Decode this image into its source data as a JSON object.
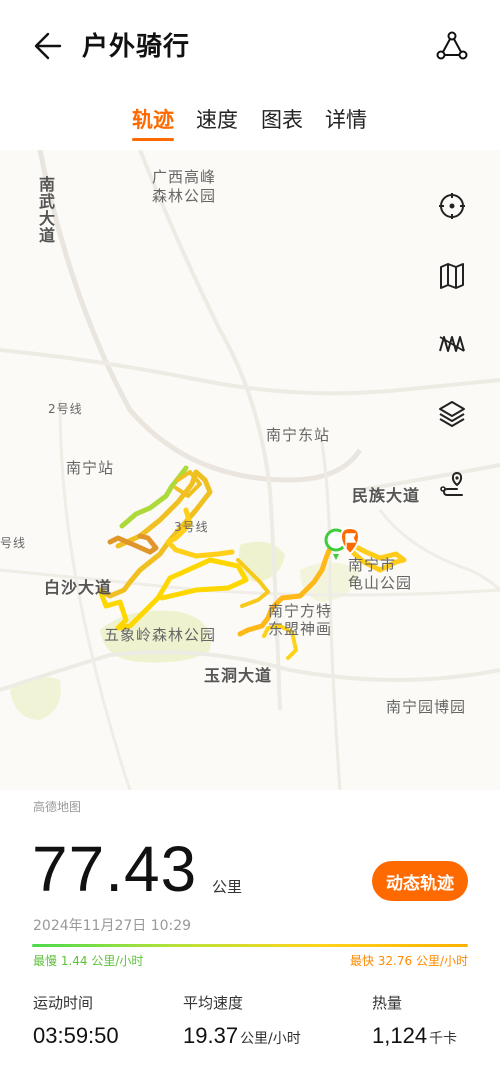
{
  "header": {
    "title": "户外骑行"
  },
  "tabs": [
    {
      "label": "轨迹"
    },
    {
      "label": "速度"
    },
    {
      "label": "图表"
    },
    {
      "label": "详情"
    }
  ],
  "map": {
    "labels": {
      "guangxi_forest": "广西高峰\n森林公园",
      "nanwu": "南武大道",
      "line2": "2号线",
      "nanning_station": "南宁站",
      "nanning_east": "南宁东站",
      "minzu": "民族大道",
      "line3": "3号线",
      "line_left": "号线",
      "baisha": "白沙大道",
      "wuxiangling": "五象岭森林公园",
      "yudong": "玉洞大道",
      "nanning_fangte": "南宁方特\n东盟神画",
      "guishan": "南宁市\n龟山公园",
      "expo_garden": "南宁园博园"
    },
    "tools": [
      {
        "icon": "locate-icon"
      },
      {
        "icon": "map-icon"
      },
      {
        "icon": "track-style-icon"
      },
      {
        "icon": "layers-icon"
      },
      {
        "icon": "route-pin-icon"
      }
    ],
    "attribution": "高德地图",
    "accent": "#ff6a00"
  },
  "summary": {
    "distance": "77.43",
    "distance_unit": "公里",
    "dynamic_button": "动态轨迹",
    "date": "2024年11月27日 10:29",
    "slowest": "最慢 1.44 公里/小时",
    "fastest": "最快 32.76 公里/小时"
  },
  "stats": [
    {
      "label": "运动时间",
      "value": "03:59:50",
      "unit": ""
    },
    {
      "label": "平均速度",
      "value": "19.37",
      "unit": "公里/小时"
    },
    {
      "label": "热量",
      "value": "1,124",
      "unit": "千卡"
    }
  ]
}
